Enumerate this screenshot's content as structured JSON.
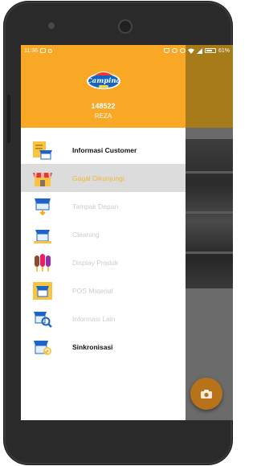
{
  "status_bar": {
    "time": "11:36",
    "battery": "61%"
  },
  "drawer": {
    "logo_text": "Campina",
    "user_id": "148522",
    "user_name": "REZA"
  },
  "menu": {
    "items": [
      {
        "label": "Informasi Customer",
        "icon": "customer-info-icon",
        "state": "enabled"
      },
      {
        "label": "Gagal Dikunjungi",
        "icon": "failed-visit-store-icon",
        "state": "active"
      },
      {
        "label": "Tampak Depan",
        "icon": "store-front-icon",
        "state": "disabled"
      },
      {
        "label": "Cleaning",
        "icon": "cleaning-icon",
        "state": "disabled"
      },
      {
        "label": "Display Produk",
        "icon": "display-product-icon",
        "state": "disabled"
      },
      {
        "label": "POS Material",
        "icon": "pos-material-icon",
        "state": "disabled"
      },
      {
        "label": "Informasi Lain",
        "icon": "other-info-icon",
        "state": "disabled"
      },
      {
        "label": "Sinkronisasi",
        "icon": "sync-icon",
        "state": "enabled"
      }
    ]
  },
  "fab": {
    "icon": "camera-icon"
  },
  "colors": {
    "header": "#f9a825",
    "active_label": "#f3b53a",
    "active_bg": "#dcdcdc",
    "fab": "#b8721a"
  }
}
